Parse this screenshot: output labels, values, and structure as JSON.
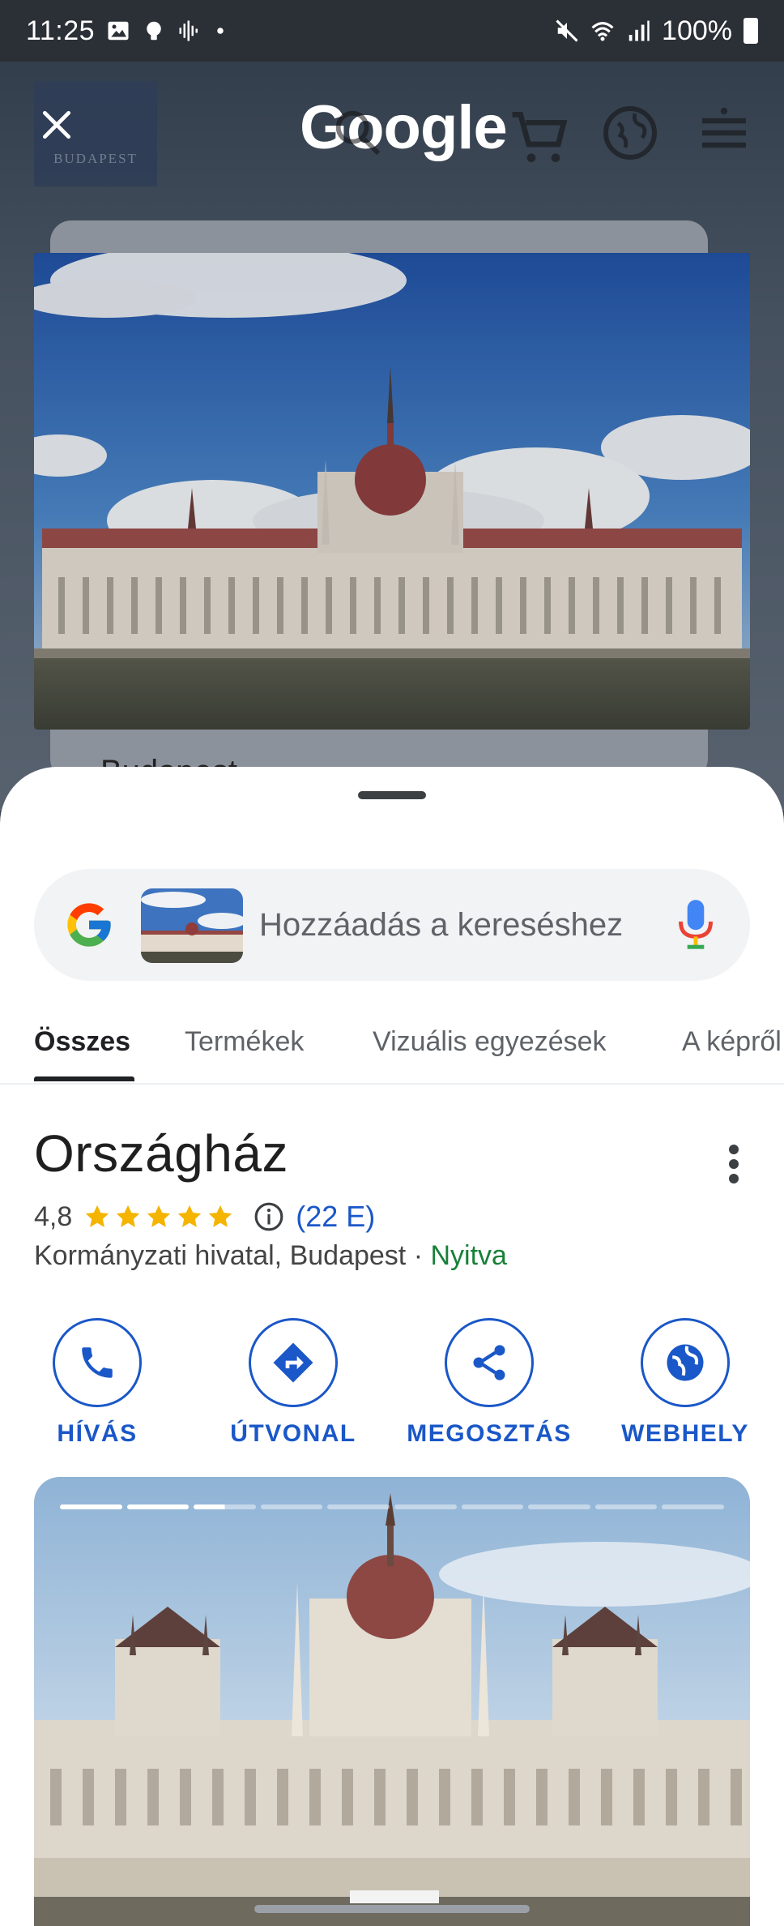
{
  "status_bar": {
    "time": "11:25",
    "battery": "100%",
    "icons": [
      "gallery-icon",
      "bulb-icon",
      "voice-wave-icon",
      "dot-icon",
      "mute-icon",
      "wifi-icon",
      "signal-icon",
      "battery-icon"
    ]
  },
  "background_site": {
    "logo_text": "BUDAPEST",
    "brand": "Google",
    "preview_caption": "Budapest",
    "icons": [
      "close-icon",
      "search-icon",
      "cart-icon",
      "globe-icon",
      "menu-icon"
    ]
  },
  "search": {
    "placeholder": "Hozzáadás a kereséshez",
    "icons": [
      "google-g-icon",
      "mic-icon"
    ]
  },
  "tabs": [
    {
      "label": "Összes",
      "active": true
    },
    {
      "label": "Termékek",
      "active": false
    },
    {
      "label": "Vizuális egyezések",
      "active": false
    },
    {
      "label": "A képről",
      "active": false
    }
  ],
  "place": {
    "name": "Országház",
    "rating": "4,8",
    "stars": 5,
    "reviews": "(22 E)",
    "category": "Kormányzati hivatal, Budapest",
    "separator": " · ",
    "status": "Nyitva"
  },
  "actions": [
    {
      "label": "HÍVÁS",
      "icon": "phone-icon"
    },
    {
      "label": "ÚTVONAL",
      "icon": "directions-icon"
    },
    {
      "label": "MEGOSZTÁS",
      "icon": "share-icon"
    },
    {
      "label": "WEBHELY",
      "icon": "website-globe-icon"
    }
  ],
  "gallery": {
    "total_images": 10,
    "current_index": 3,
    "current_progress": 0.5
  },
  "colors": {
    "accent_blue": "#1a57c8",
    "open_green": "#188038",
    "star_yellow": "#f4b400"
  }
}
